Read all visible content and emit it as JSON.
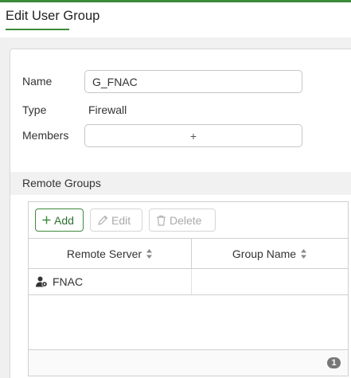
{
  "page": {
    "title": "Edit User Group"
  },
  "form": {
    "name_label": "Name",
    "name_value": "G_FNAC",
    "type_label": "Type",
    "type_value": "Firewall",
    "members_label": "Members",
    "members_add_symbol": "+"
  },
  "remote_groups": {
    "section_title": "Remote Groups",
    "toolbar": {
      "add_label": "Add",
      "edit_label": "Edit",
      "delete_label": "Delete"
    },
    "columns": [
      "Remote Server",
      "Group Name"
    ],
    "rows": [
      {
        "remote_server": "FNAC",
        "group_name": "",
        "icon": "user-server-icon"
      }
    ],
    "row_count": "1"
  },
  "colors": {
    "accent_green": "#3c8a3c",
    "disabled_text": "#aaaaaa",
    "badge_gray": "#777777"
  },
  "icons": {
    "add": "plus-icon",
    "edit": "pencil-icon",
    "delete": "trash-icon",
    "sort": "sort-icon"
  }
}
